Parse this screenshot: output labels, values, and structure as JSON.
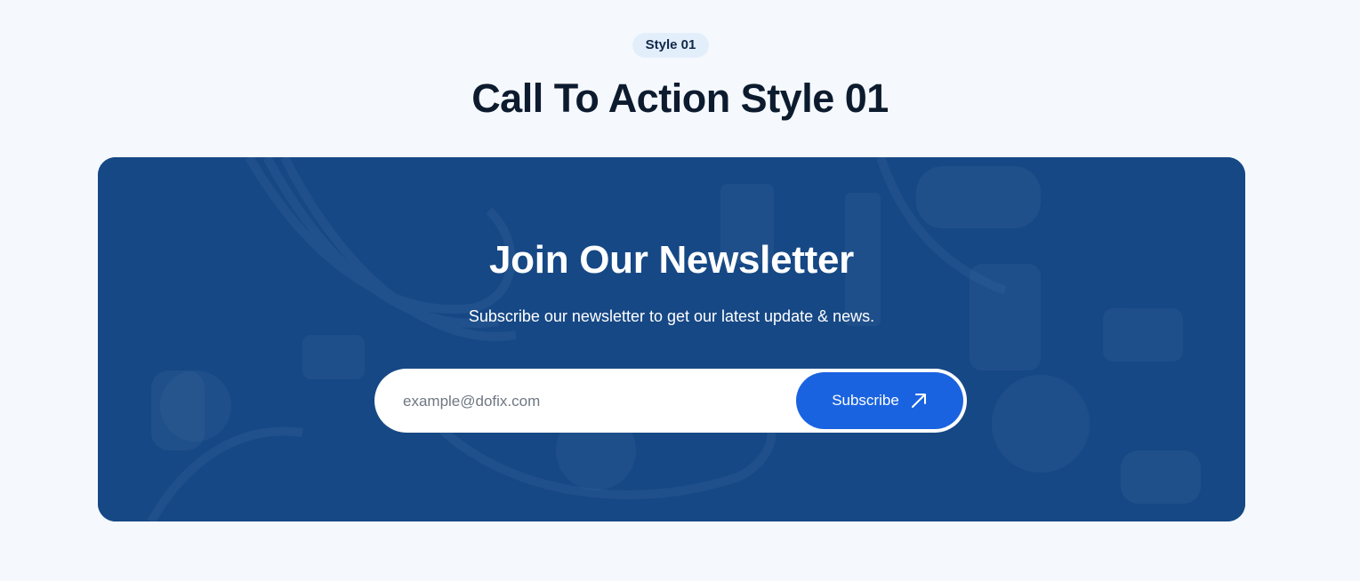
{
  "header": {
    "badge": "Style 01",
    "title": "Call To Action Style 01"
  },
  "cta": {
    "title": "Join Our Newsletter",
    "subtitle": "Subscribe our newsletter to get our latest update & news.",
    "email_placeholder": "example@dofix.com",
    "subscribe_label": "Subscribe",
    "subscribe_icon": "arrow-up-right-icon",
    "background_image": "plumbing-tools-photo"
  },
  "colors": {
    "page_background": "#f5f9fe",
    "card_overlay": "#15477f",
    "button": "#1a63e0",
    "title_text": "#0d1b2e"
  }
}
